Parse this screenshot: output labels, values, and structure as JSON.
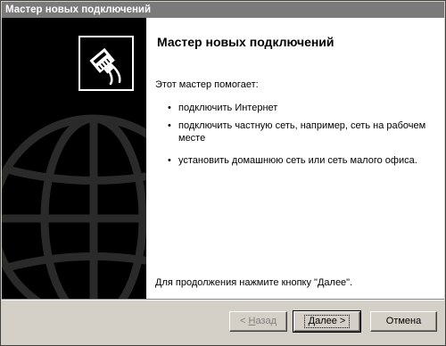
{
  "window": {
    "title": "Мастер новых подключений"
  },
  "wizard": {
    "heading": "Мастер новых подключений",
    "intro": "Этот мастер помогает:",
    "bullets": [
      "подключить Интернет",
      "подключить частную сеть, например, сеть на рабочем месте",
      "установить домашнюю сеть или сеть малого офиса."
    ],
    "footer": "Для продолжения нажмите кнопку \"Далее\"."
  },
  "buttons": {
    "back": {
      "arrow": "<",
      "accel": "Н",
      "rest": "азад"
    },
    "next": {
      "accel": "Д",
      "rest": "алее",
      "arrow": ">"
    },
    "cancel": "Отмена"
  },
  "icons": {
    "logo": "network-cable-icon",
    "background": "globe-watermark-icon"
  }
}
